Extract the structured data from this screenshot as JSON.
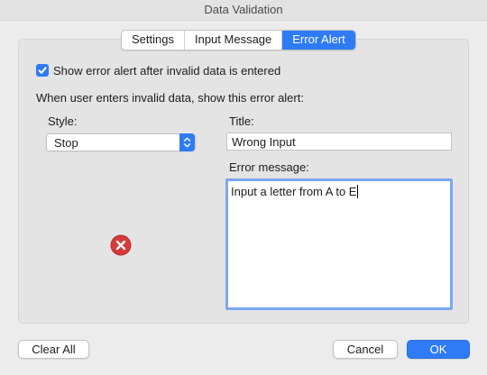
{
  "window": {
    "title": "Data Validation"
  },
  "tabs": [
    {
      "label": "Settings",
      "active": false
    },
    {
      "label": "Input Message",
      "active": false
    },
    {
      "label": "Error Alert",
      "active": true
    }
  ],
  "error_alert": {
    "show_alert_label": "Show error alert after invalid data is entered",
    "show_alert_checked": true,
    "instruction": "When user enters invalid data, show this error alert:",
    "style_label": "Style:",
    "style_value": "Stop",
    "title_label": "Title:",
    "title_value": "Wrong Input",
    "message_label": "Error message:",
    "message_value": "Input a letter from A to E",
    "style_icon": "stop-error-icon"
  },
  "buttons": {
    "clear_all": "Clear All",
    "cancel": "Cancel",
    "ok": "OK"
  },
  "colors": {
    "accent": "#2f7bf5",
    "stop_red": "#d63a3a"
  }
}
